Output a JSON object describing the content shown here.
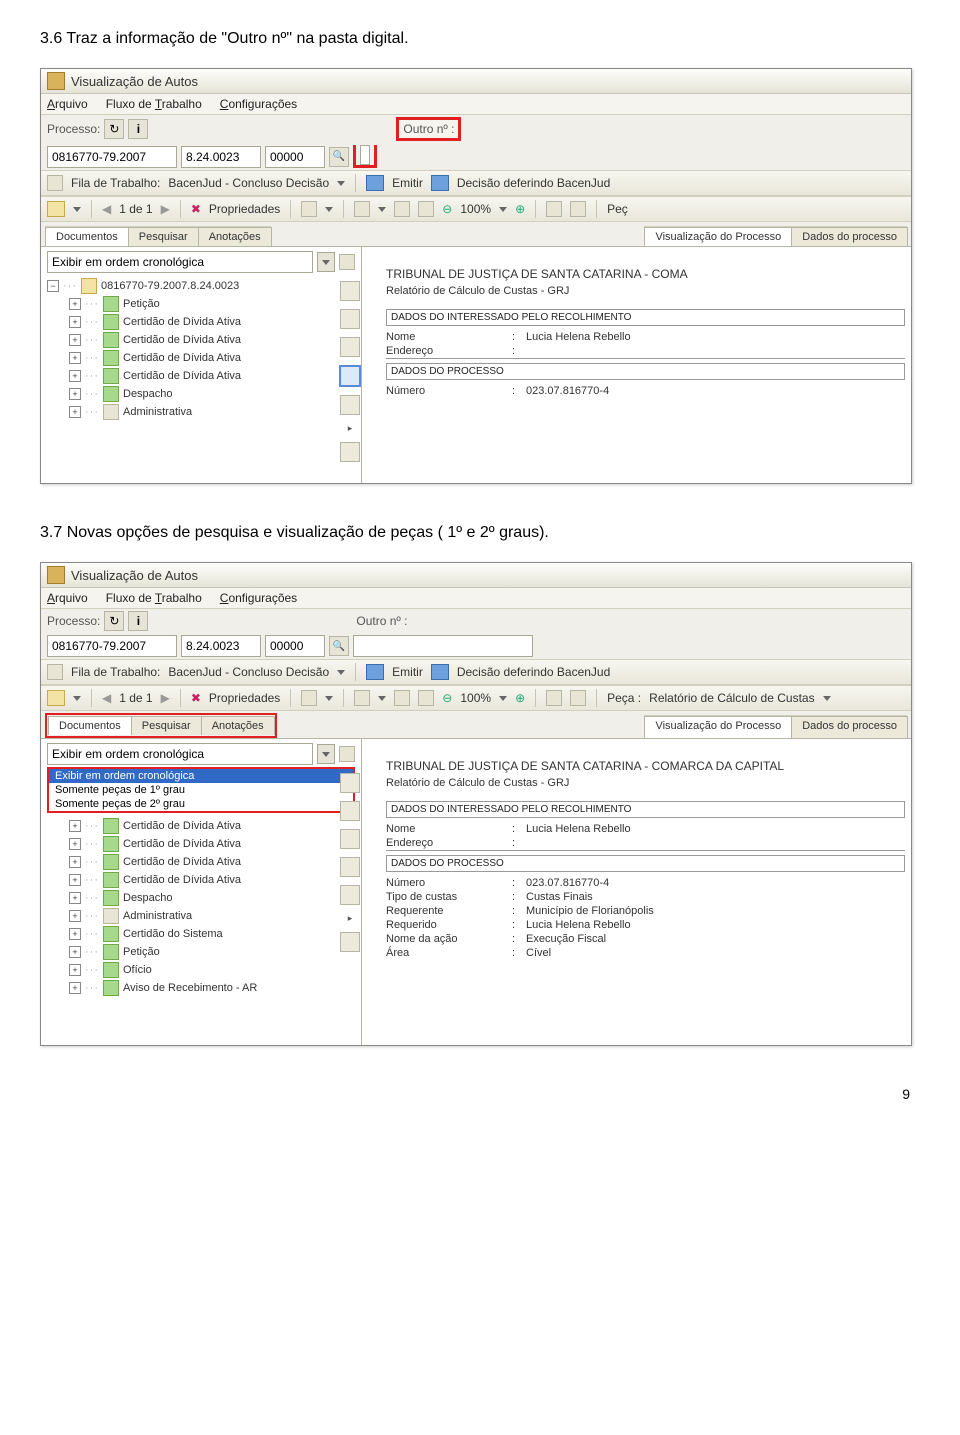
{
  "captions": {
    "c1": "3.6  Traz a informação de \"Outro nº\" na pasta digital.",
    "c2": "3.7  Novas opções de pesquisa e visualização de peças ( 1º e 2º graus)."
  },
  "window_title": "Visualização de Autos",
  "menu": {
    "arquivo": "Arquivo",
    "fluxo": "Fluxo de Trabalho",
    "config": "Configurações"
  },
  "processo": {
    "label": "Processo:",
    "num": "0816770-79.2007",
    "p2": "8.24.0023",
    "p3": "00000",
    "outro_label": "Outro nº :",
    "outro_value": ""
  },
  "filabar": {
    "fila_label": "Fila de Trabalho:",
    "fila_value": "BacenJud - Concluso Decisão",
    "emitir": "Emitir",
    "decisao": "Decisão deferindo BacenJud"
  },
  "toolbar": {
    "pageinfo": "1 de 1",
    "propriedades": "Propriedades",
    "zoom": "100%",
    "peca_short": "Peç",
    "peca_full": "Peça :",
    "peca_value": "Relatório de Cálculo de Custas"
  },
  "tabs_left": {
    "documentos": "Documentos",
    "pesquisar": "Pesquisar",
    "anotacoes": "Anotações"
  },
  "tabs_right": {
    "visualizacao": "Visualização do Processo",
    "dados": "Dados do processo"
  },
  "left_combo": "Exibir em ordem cronológica",
  "dropdown": {
    "opt1": "Exibir em ordem cronológica",
    "opt2": "Somente peças de 1º grau",
    "opt3": "Somente peças de 2º grau"
  },
  "tree1": {
    "root": "0816770-79.2007.8.24.0023",
    "items": [
      "Petição",
      "Certidão de Dívida Ativa",
      "Certidão de Dívida Ativa",
      "Certidão de Dívida Ativa",
      "Certidão de Dívida Ativa",
      "Despacho",
      "Administrativa"
    ]
  },
  "tree2_items": [
    "Certidão de Dívida Ativa",
    "Certidão de Dívida Ativa",
    "Certidão de Dívida Ativa",
    "Certidão de Dívida Ativa",
    "Despacho",
    "Administrativa",
    "Certidão do Sistema",
    "Petição",
    "Ofício",
    "Aviso de Recebimento - AR"
  ],
  "doc1": {
    "heading": "TRIBUNAL DE JUSTIÇA DE SANTA CATARINA - COMA",
    "sub": "Relatório de Cálculo de Custas - GRJ",
    "sec1": "DADOS DO INTERESSADO PELO RECOLHIMENTO",
    "nome_k": "Nome",
    "nome_v": "Lucia Helena Rebello",
    "end_k": "Endereço",
    "end_v": "",
    "sec2": "DADOS DO PROCESSO",
    "num_k": "Número",
    "num_v": "023.07.816770-4"
  },
  "doc2": {
    "heading": "TRIBUNAL DE JUSTIÇA DE SANTA CATARINA - COMARCA DA CAPITAL",
    "sub": "Relatório de Cálculo de Custas - GRJ",
    "sec1": "DADOS DO INTERESSADO PELO RECOLHIMENTO",
    "nome_k": "Nome",
    "nome_v": "Lucia Helena Rebello",
    "end_k": "Endereço",
    "end_v": "",
    "sec2": "DADOS DO PROCESSO",
    "num_k": "Número",
    "num_v": "023.07.816770-4",
    "tipo_k": "Tipo de custas",
    "tipo_v": "Custas Finais",
    "reqte_k": "Requerente",
    "reqte_v": "Município de Florianópolis",
    "reqdo_k": "Requerido",
    "reqdo_v": "Lucia Helena Rebello",
    "acao_k": "Nome da ação",
    "acao_v": "Execução Fiscal",
    "area_k": "Área",
    "area_v": "Cível"
  },
  "page_number": "9"
}
